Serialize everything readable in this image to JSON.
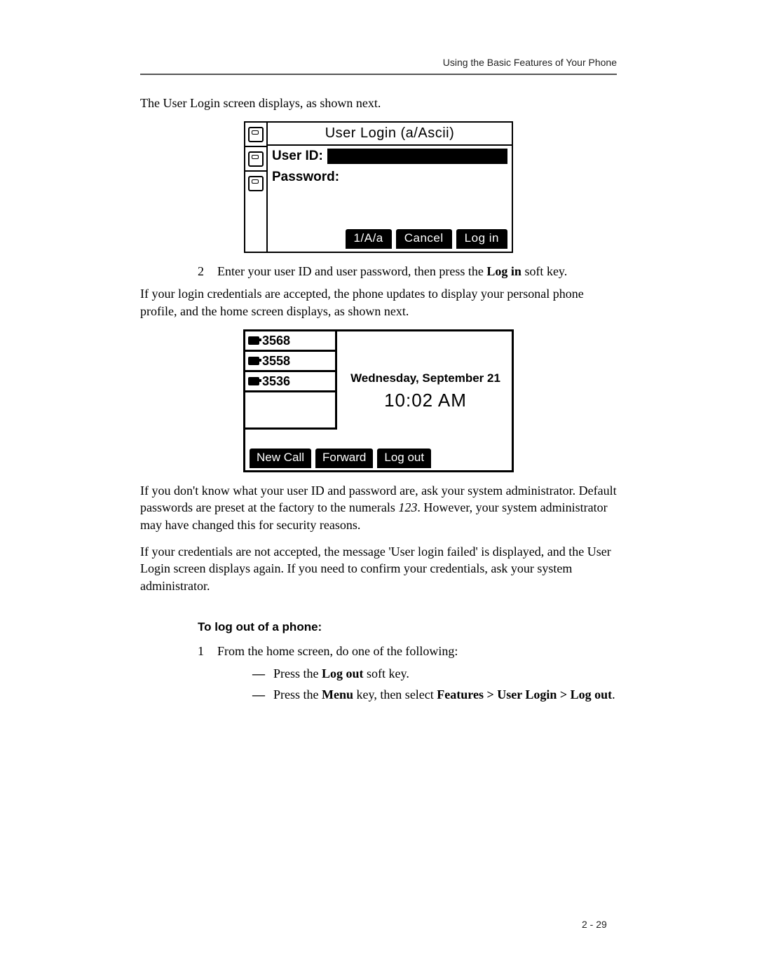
{
  "header": {
    "running": "Using the Basic Features of Your Phone"
  },
  "intro_login": "The User Login screen displays, as shown next.",
  "login_screen": {
    "title": "User Login (a/Ascii)",
    "fields": {
      "user_id_label": "User ID:",
      "password_label": "Password:"
    },
    "softkeys": {
      "mode": "1/A/a",
      "cancel": "Cancel",
      "login": "Log in"
    }
  },
  "step2": {
    "num": "2",
    "text_a": "Enter your user ID and user password, then press the ",
    "text_b": "Log in",
    "text_c": " soft key."
  },
  "accepted": "If your login credentials are accepted, the phone updates to display your personal phone profile, and the home screen displays, as shown next.",
  "home_screen": {
    "lines": [
      "3568",
      "3558",
      "3536"
    ],
    "date": "Wednesday, September 21",
    "time": "10:02 AM",
    "softkeys": {
      "newcall": "New Call",
      "forward": "Forward",
      "logout": "Log out"
    }
  },
  "unknown": {
    "a": "If you don't know what your user ID and password are, ask your system administrator. Default passwords are preset at the factory to the numerals ",
    "b": "123",
    "c": ". However, your system administrator may have changed this for security reasons."
  },
  "failed": "If your credentials are not accepted, the message 'User login failed' is displayed, and the User Login screen displays again. If you need to confirm your credentials, ask your system administrator.",
  "logout_section": {
    "heading": "To log out of a phone:",
    "step1_num": "1",
    "step1_text": "From the home screen, do one of the following:",
    "opt1_a": "Press the ",
    "opt1_b": "Log out",
    "opt1_c": " soft key.",
    "opt2_a": "Press the ",
    "opt2_b": "Menu",
    "opt2_c": " key, then select ",
    "opt2_d": "Features > User Login > Log out",
    "opt2_e": "."
  },
  "pagenum": "2 - 29"
}
